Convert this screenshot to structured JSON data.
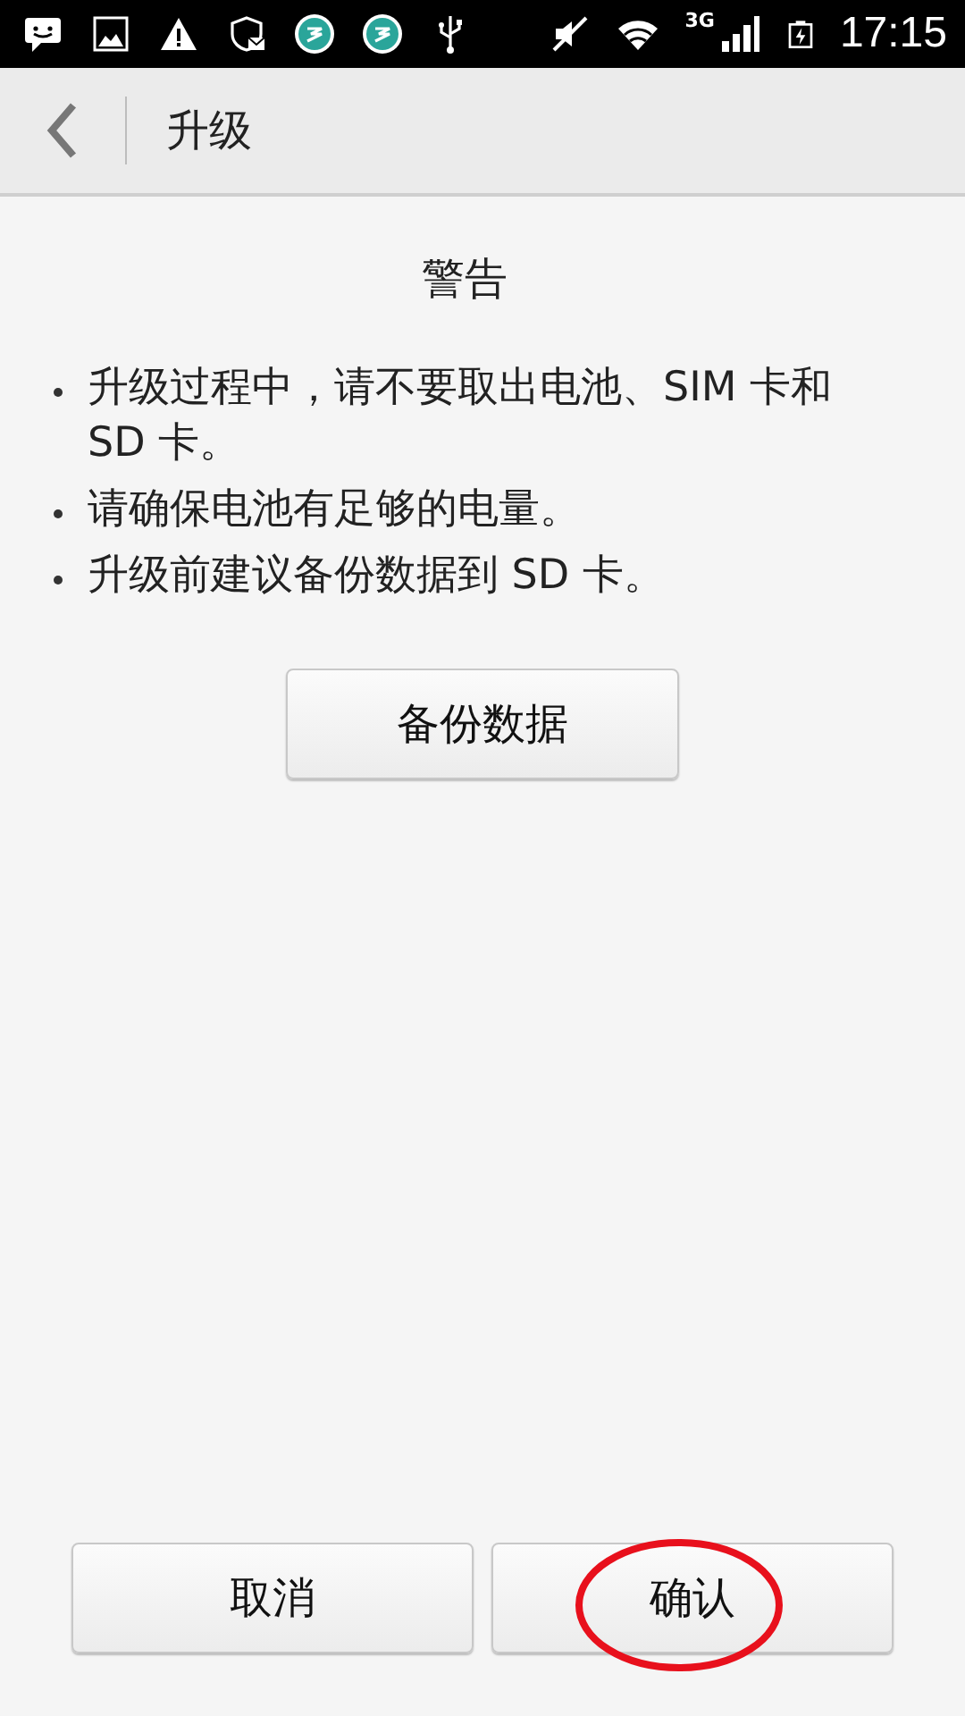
{
  "status_bar": {
    "network": "3G",
    "time": "17:15"
  },
  "header": {
    "title": "升级"
  },
  "warning": {
    "title": "警告",
    "items": [
      "升级过程中，请不要取出电池、SIM 卡和 SD 卡。",
      "请确保电池有足够的电量。",
      "升级前建议备份数据到 SD 卡。"
    ],
    "action": "备份数据"
  },
  "buttons": [
    {
      "label": "取消",
      "highlighted": false
    },
    {
      "label": "确认",
      "highlighted": true
    }
  ]
}
